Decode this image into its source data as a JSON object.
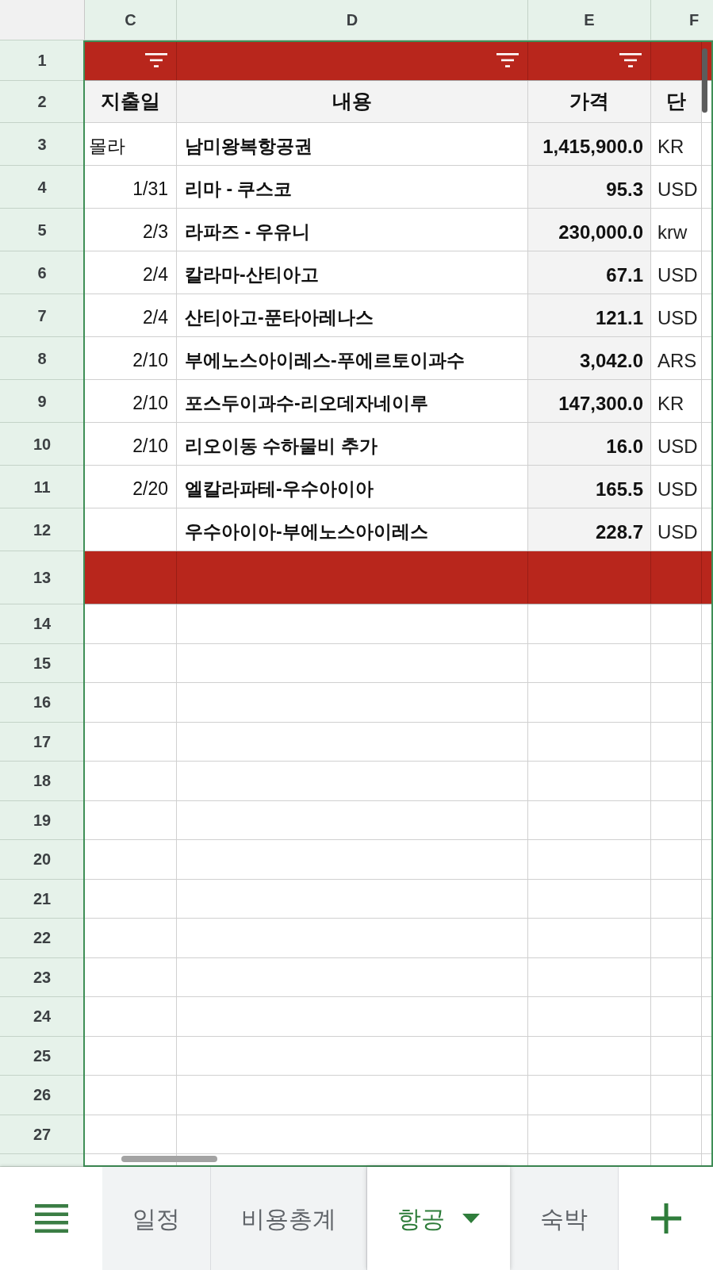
{
  "grid": {
    "column_headers": [
      "C",
      "D",
      "E",
      "F"
    ],
    "rows": [
      {
        "number": "1",
        "kind": "filter",
        "filter_buttons": [
          true,
          true,
          true,
          false
        ]
      },
      {
        "number": "2",
        "kind": "header",
        "cells": [
          "지출일",
          "내용",
          "가격",
          "단"
        ]
      },
      {
        "number": "3",
        "kind": "data",
        "date": {
          "text": "몰라",
          "kind": "text"
        },
        "content": "남미왕복항공권",
        "price": "1,415,900.0",
        "unit": "KR"
      },
      {
        "number": "4",
        "kind": "data",
        "date": {
          "text": "1/31",
          "kind": "number"
        },
        "content": "리마 - 쿠스코",
        "price": "95.3",
        "unit": "USD"
      },
      {
        "number": "5",
        "kind": "data",
        "date": {
          "text": "2/3",
          "kind": "number"
        },
        "content": "라파즈 - 우유니",
        "price": "230,000.0",
        "unit": "krw"
      },
      {
        "number": "6",
        "kind": "data",
        "date": {
          "text": "2/4",
          "kind": "number"
        },
        "content": "칼라마-산티아고",
        "price": "67.1",
        "unit": "USD"
      },
      {
        "number": "7",
        "kind": "data",
        "date": {
          "text": "2/4",
          "kind": "number"
        },
        "content": "산티아고-푼타아레나스",
        "price": "121.1",
        "unit": "USD"
      },
      {
        "number": "8",
        "kind": "data",
        "date": {
          "text": "2/10",
          "kind": "number"
        },
        "content": "부에노스아이레스-푸에르토이과수",
        "price": "3,042.0",
        "unit": "ARS"
      },
      {
        "number": "9",
        "kind": "data",
        "date": {
          "text": "2/10",
          "kind": "number"
        },
        "content": "포스두이과수-리오데자네이루",
        "price": "147,300.0",
        "unit": "KR"
      },
      {
        "number": "10",
        "kind": "data",
        "date": {
          "text": "2/10",
          "kind": "number"
        },
        "content": "리오이동 수하물비 추가",
        "price": "16.0",
        "unit": "USD"
      },
      {
        "number": "11",
        "kind": "data",
        "date": {
          "text": "2/20",
          "kind": "number"
        },
        "content": "엘칼라파테-우수아이아",
        "price": "165.5",
        "unit": "USD"
      },
      {
        "number": "12",
        "kind": "data",
        "content": "우수아이아-부에노스아이레스",
        "price": "228.7",
        "unit": "USD"
      },
      {
        "number": "13",
        "kind": "band"
      },
      {
        "number": "14",
        "kind": "empty"
      },
      {
        "number": "15",
        "kind": "empty"
      },
      {
        "number": "16",
        "kind": "empty"
      },
      {
        "number": "17",
        "kind": "empty"
      },
      {
        "number": "18",
        "kind": "empty"
      },
      {
        "number": "19",
        "kind": "empty"
      },
      {
        "number": "20",
        "kind": "empty"
      },
      {
        "number": "21",
        "kind": "empty"
      },
      {
        "number": "22",
        "kind": "empty"
      },
      {
        "number": "23",
        "kind": "empty"
      },
      {
        "number": "24",
        "kind": "empty"
      },
      {
        "number": "25",
        "kind": "empty"
      },
      {
        "number": "26",
        "kind": "empty"
      },
      {
        "number": "27",
        "kind": "empty"
      }
    ]
  },
  "sheet_tabs": [
    {
      "label": "일정",
      "selected": false
    },
    {
      "label": "비용총계",
      "selected": false
    },
    {
      "label": "항공",
      "selected": true
    },
    {
      "label": "숙박",
      "selected": false
    }
  ]
}
